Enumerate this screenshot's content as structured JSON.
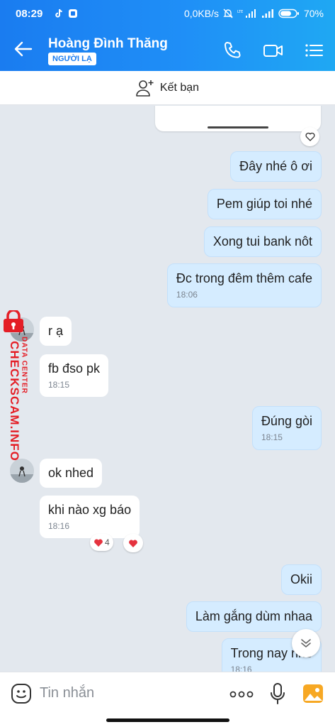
{
  "status_bar": {
    "time": "08:29",
    "network_speed": "0,0KB/s",
    "battery": "70%"
  },
  "header": {
    "contact_name": "Hoàng Đình Thăng",
    "badge": "NGƯỜI LẠ"
  },
  "add_friend": {
    "label": "Kết bạn"
  },
  "messages": [
    {
      "text": "Đây nhé ô ơi",
      "from": "me"
    },
    {
      "text": "Pem giúp toi nhé",
      "from": "me"
    },
    {
      "text": "Xong tui bank nôt",
      "from": "me"
    },
    {
      "text": "Đc trong đêm thêm cafe",
      "from": "me",
      "time": "18:06"
    },
    {
      "text": "r ạ",
      "from": "them"
    },
    {
      "text": "fb đso pk",
      "from": "them",
      "time": "18:15"
    },
    {
      "text": "Đúng gòi",
      "from": "me",
      "time": "18:15"
    },
    {
      "text": "ok nhed",
      "from": "them"
    },
    {
      "text": "khi nào xg báo",
      "from": "them",
      "time": "18:16",
      "reaction_count": "4"
    },
    {
      "text": "Okii",
      "from": "me"
    },
    {
      "text": "Làm gắng dùm nhaa",
      "from": "me"
    },
    {
      "text": "Trong nay nhé",
      "from": "me",
      "time": "18:16"
    }
  ],
  "watermark": {
    "brand": "CHECKSCAM.INFO",
    "subtitle": "DATA CENTER"
  },
  "composer": {
    "placeholder": "Tin nhắn"
  },
  "colors": {
    "header_start": "#1a7cf0",
    "header_end": "#1fa8f3",
    "my_bubble": "#d5ecff",
    "their_bubble": "#ffffff",
    "watermark": "#e41e26"
  }
}
